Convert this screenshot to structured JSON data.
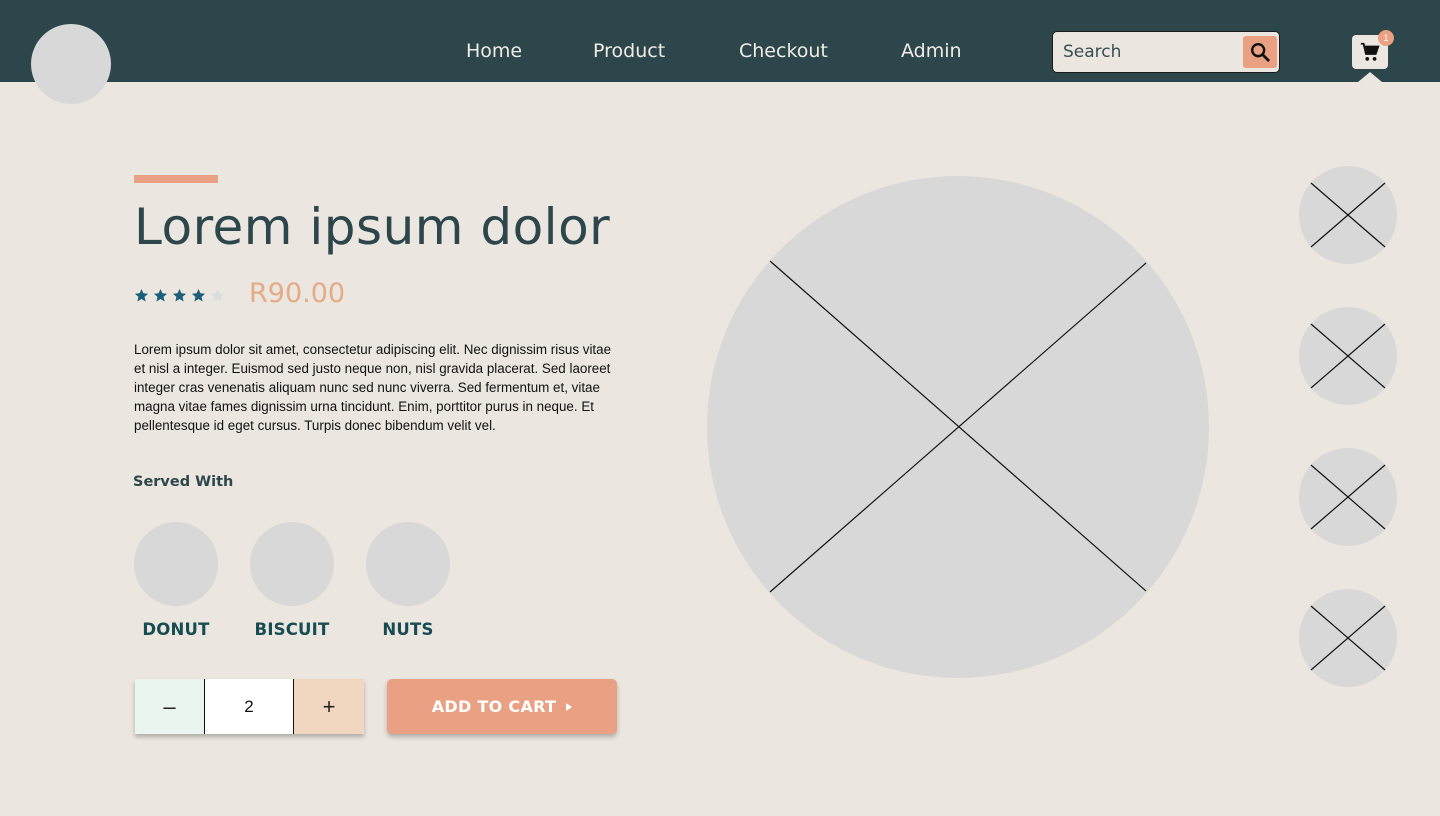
{
  "header": {
    "logo": "logo-placeholder",
    "nav": [
      {
        "label": "Home"
      },
      {
        "label": "Product"
      },
      {
        "label": "Checkout"
      },
      {
        "label": "Admin"
      }
    ],
    "search": {
      "placeholder": "Search",
      "icon": "search-icon"
    },
    "cart": {
      "icon": "cart-icon",
      "count": "1"
    }
  },
  "product": {
    "title": "Lorem ipsum dolor",
    "rating": {
      "value": 4,
      "max": 5
    },
    "price": "R90.00",
    "description": "Lorem ipsum dolor sit amet, consectetur adipiscing elit. Nec dignissim risus vitae et nisl a integer. Euismod sed justo neque non, nisl gravida placerat. Sed laoreet integer cras venenatis aliquam nunc sed nunc viverra. Sed fermentum et, vitae magna vitae fames dignissim urna tincidunt. Enim, porttitor purus in neque. Et pellentesque id eget cursus. Turpis donec bibendum velit vel.",
    "served_with_title": "Served With",
    "served_with": [
      {
        "label": "DONUT"
      },
      {
        "label": "BISCUIT"
      },
      {
        "label": "NUTS"
      }
    ],
    "quantity": {
      "value": "2",
      "minus": "–",
      "plus": "+"
    },
    "add_to_cart": "ADD TO CART"
  },
  "colors": {
    "header_bg": "#2c464b",
    "page_bg": "#ebe6df",
    "accent": "#e9a083",
    "price": "#e4ab85",
    "star_filled": "#1d5f7a",
    "star_empty": "#d9dde0",
    "placeholder": "#d8d8d8"
  }
}
